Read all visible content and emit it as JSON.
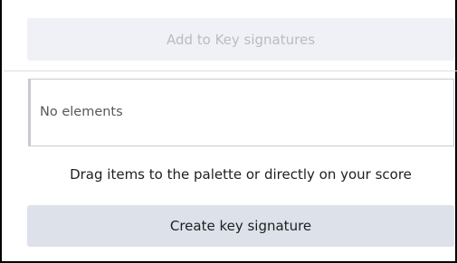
{
  "add_button": {
    "label": "Add to Key signatures",
    "state": "disabled"
  },
  "elements_list": {
    "empty_text": "No elements"
  },
  "hint": {
    "text": "Drag items to the palette or directly on your score"
  },
  "create_button": {
    "label": "Create key signature"
  },
  "colors": {
    "disabled_button_bg": "#eff1f6",
    "disabled_text": "#b9bcc2",
    "button_bg": "#dde1e9",
    "text": "#1e1f22",
    "border": "#c7cacf"
  }
}
